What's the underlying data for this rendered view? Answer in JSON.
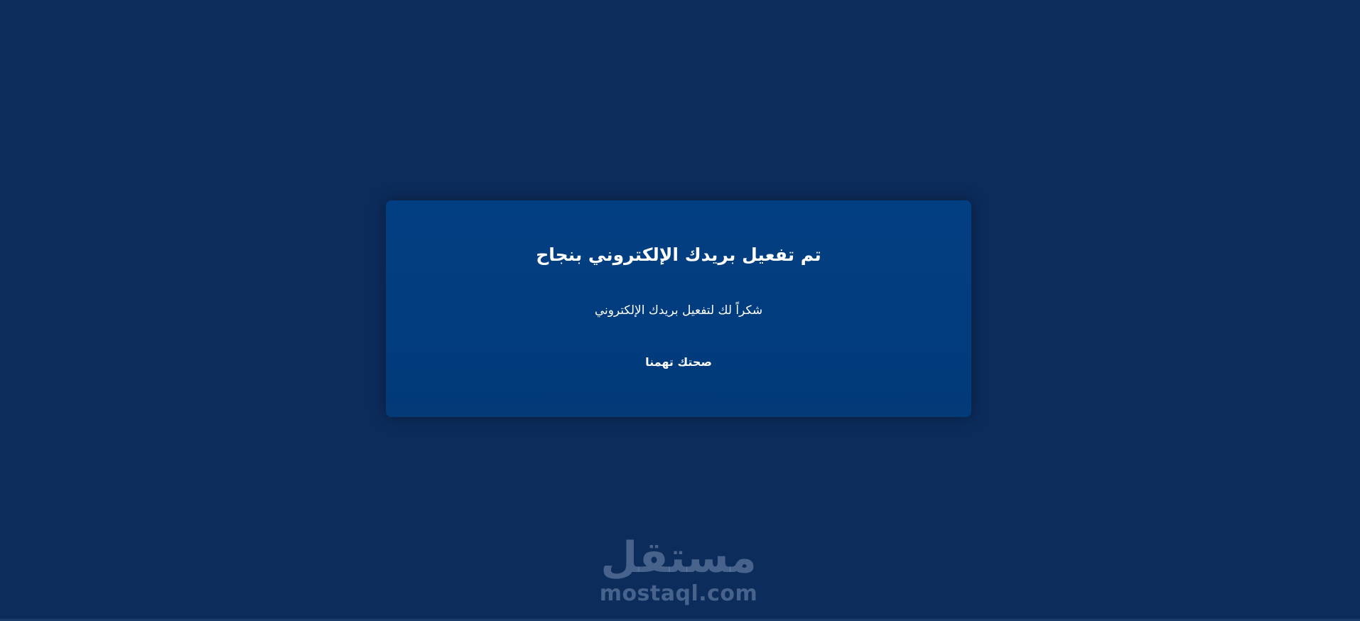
{
  "card": {
    "title": "تم تفعيل بريدك الإلكتروني بنجاح",
    "message": "شكراً لك لتفعيل بريدك الإلكتروني",
    "signoff": "صحتك تهمنا"
  },
  "watermark": {
    "arabic": "مستقل",
    "latin": "mostaql.com"
  },
  "colors": {
    "background": "#0c2c5b",
    "card": "#023f82",
    "text": "#ffffff"
  }
}
